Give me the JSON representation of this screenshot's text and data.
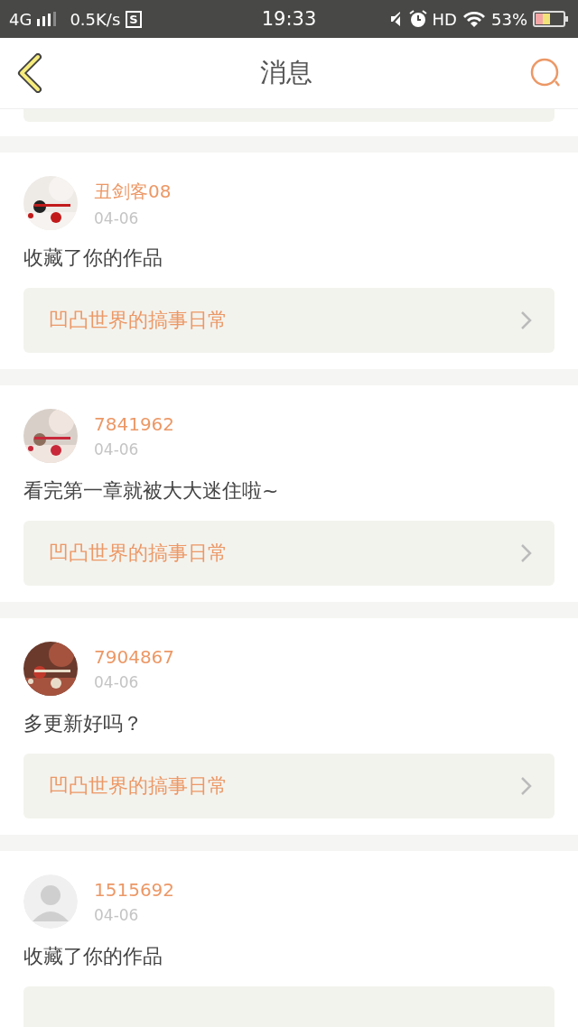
{
  "status_bar": {
    "network": "4G",
    "speed": "0.5K/s",
    "app_badge": "S",
    "time": "19:33",
    "hd": "HD",
    "battery_text": "53%"
  },
  "header": {
    "title": "消息"
  },
  "messages": [
    {
      "name": "丑剑客08",
      "date": "04-06",
      "kind": "picture",
      "text": "收藏了你的作品",
      "work_title": "凹凸世界的搞事日常"
    },
    {
      "name": "7841962",
      "date": "04-06",
      "kind": "picture",
      "text": "看完第一章就被大大迷住啦~",
      "work_title": "凹凸世界的搞事日常"
    },
    {
      "name": "7904867",
      "date": "04-06",
      "kind": "picture",
      "text": "多更新好吗？",
      "work_title": "凹凸世界的搞事日常"
    },
    {
      "name": "1515692",
      "date": "04-06",
      "kind": "silhouette",
      "text": "收藏了你的作品"
    }
  ]
}
